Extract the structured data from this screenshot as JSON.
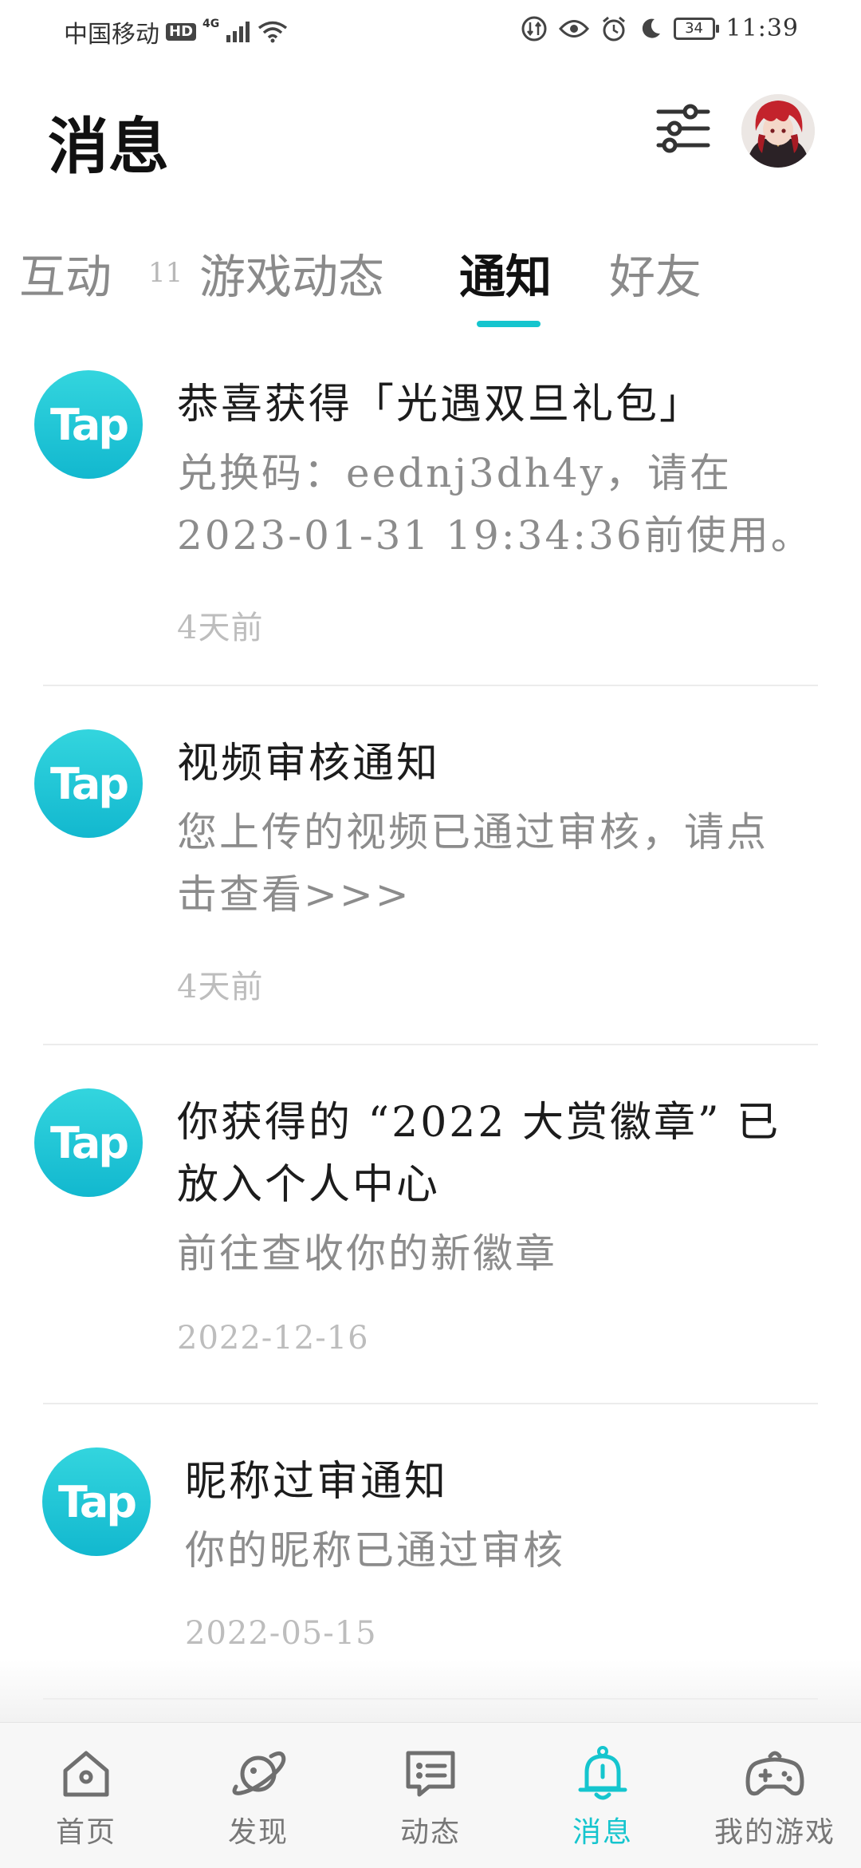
{
  "status_bar": {
    "carrier": "中国移动",
    "hd": "HD",
    "network": "4G",
    "battery": "34",
    "time": "11:39"
  },
  "header": {
    "title": "消息",
    "settings_icon": "sliders-icon",
    "avatar_icon": "avatar-image"
  },
  "tabs": [
    {
      "label": "互动",
      "badge": "11"
    },
    {
      "label": "游戏动态"
    },
    {
      "label": "通知",
      "active": true
    },
    {
      "label": "好友"
    }
  ],
  "accent_color": "#15c5ce",
  "notifications": [
    {
      "logo": "Tap",
      "title": "恭喜获得「光遇双旦礼包」",
      "body_line1": "兑换码：eednj3dh4y，请在",
      "body_line2": "2023-01-31 19:34:36前使用。",
      "time": "4天前"
    },
    {
      "logo": "Tap",
      "title": "视频审核通知",
      "body_line1": "您上传的视频已通过审核，请点",
      "body_line2": "击查看>>>",
      "time": "4天前"
    },
    {
      "logo": "Tap",
      "title_line1": "你获得的 “2022 大赏徽章” 已",
      "title_line2": "放入个人中心",
      "body_line1": "前往查收你的新徽章",
      "time": "2022-12-16"
    },
    {
      "logo": "Tap",
      "title": "昵称过审通知",
      "body_line1": "你的昵称已通过审核",
      "time": "2022-05-15"
    }
  ],
  "bottom_nav": [
    {
      "label": "首页",
      "icon": "home-icon"
    },
    {
      "label": "发现",
      "icon": "planet-icon"
    },
    {
      "label": "动态",
      "icon": "chat-card-icon"
    },
    {
      "label": "消息",
      "icon": "bell-icon",
      "active": true
    },
    {
      "label": "我的游戏",
      "icon": "gamepad-icon"
    }
  ]
}
